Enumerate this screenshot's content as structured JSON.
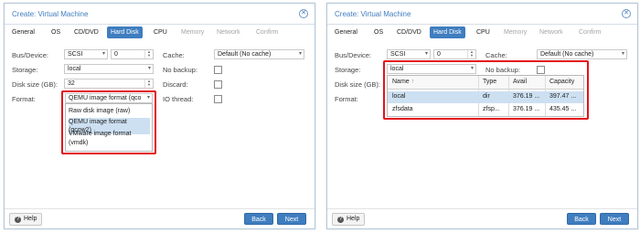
{
  "dialog_title": "Create: Virtual Machine",
  "tabs": [
    "General",
    "OS",
    "CD/DVD",
    "Hard Disk",
    "CPU",
    "Memory",
    "Network",
    "Confirm"
  ],
  "labels": {
    "bus_device": "Bus/Device:",
    "storage": "Storage:",
    "disk_size": "Disk size (GB):",
    "format": "Format:",
    "cache": "Cache:",
    "no_backup": "No backup:",
    "discard": "Discard:",
    "io_thread": "IO thread:"
  },
  "values": {
    "bus": "SCSI",
    "device": "0",
    "storage": "local",
    "disk_size": "32",
    "format": "QEMU image format (qco",
    "cache": "Default (No cache)"
  },
  "format_options": [
    "Raw disk image (raw)",
    "QEMU image format (qcow2)",
    "VMware image format",
    "(vmdk)"
  ],
  "storage_grid": {
    "columns": [
      "Name",
      "Type",
      "Avail",
      "Capacity"
    ],
    "sort_indicator": "↑",
    "rows": [
      {
        "name": "local",
        "type": "dir",
        "avail": "376.19 ...",
        "capacity": "397.47 ..."
      },
      {
        "name": "zfsdata",
        "type": "zfsp...",
        "avail": "376.19 ...",
        "capacity": "435.45 ..."
      }
    ]
  },
  "footer": {
    "help": "Help",
    "back": "Back",
    "next": "Next"
  },
  "icons": {
    "close": "close-icon",
    "help": "help-icon",
    "dropdown": "chevron-down-icon"
  },
  "colors": {
    "accent": "#3f7dbf",
    "highlight": "#e3131b",
    "selection": "#cde0f2"
  }
}
